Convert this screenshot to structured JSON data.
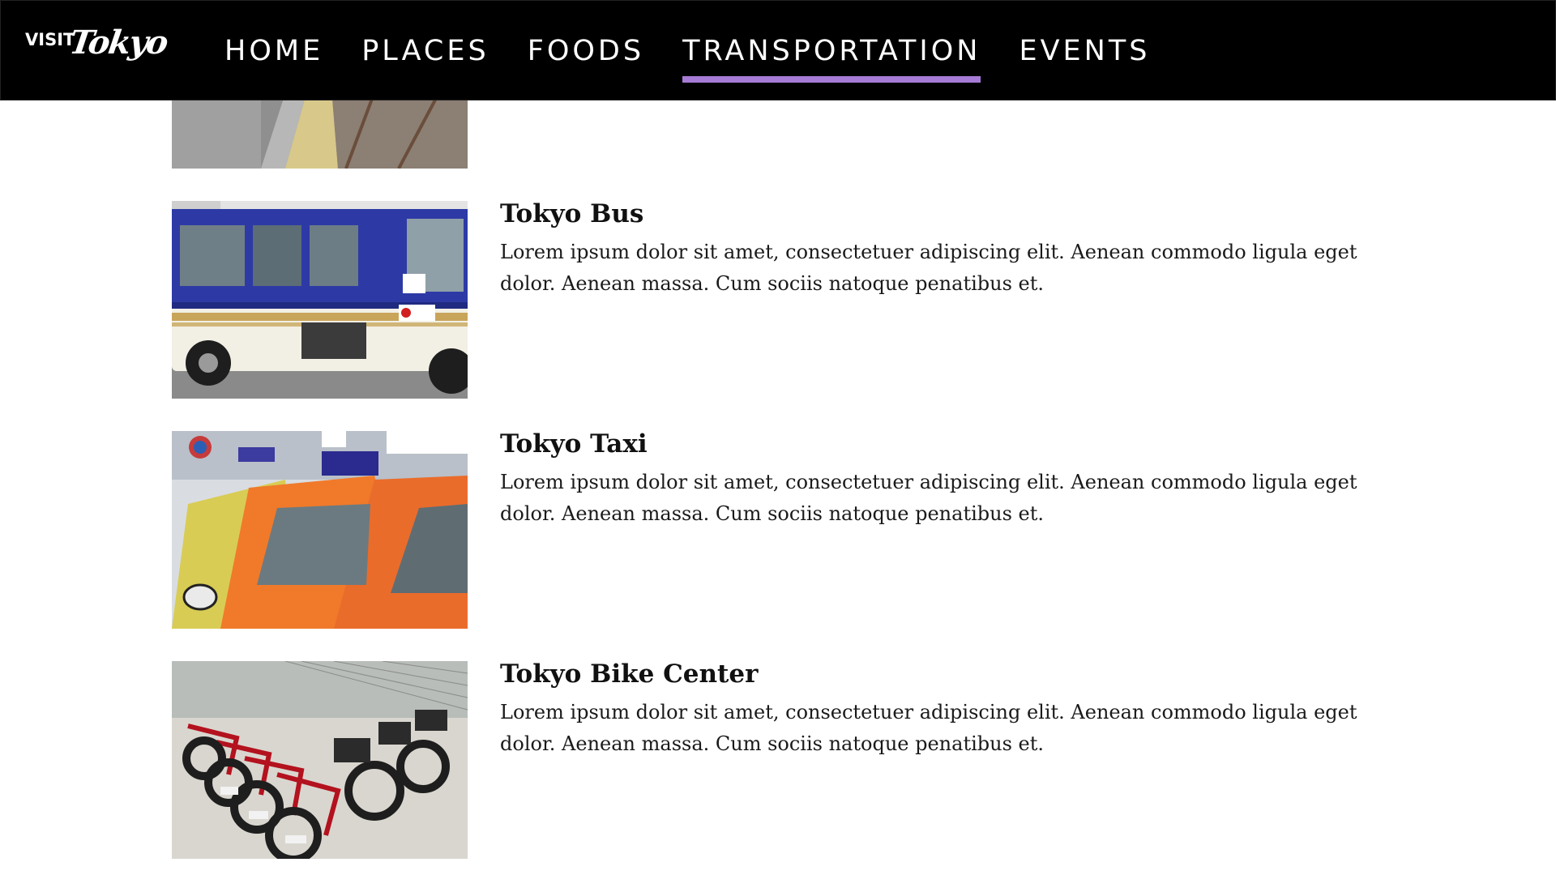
{
  "brand": {
    "logo_visit": "VISIT",
    "logo_tokyo": "Tokyo"
  },
  "nav": {
    "items": [
      {
        "label": "HOME"
      },
      {
        "label": "PLACES"
      },
      {
        "label": "FOODS"
      },
      {
        "label": "TRANSPORTATION",
        "active": true
      },
      {
        "label": "EVENTS"
      }
    ]
  },
  "colors": {
    "header_bg": "#000000",
    "accent": "#a57bd6",
    "text": "#111111"
  },
  "transport": [
    {
      "title": "",
      "image_icon": "train-platform-image"
    },
    {
      "title": "Tokyo Bus",
      "text": "Lorem ipsum dolor sit amet, consectetuer adipiscing elit. Aenean commodo ligula eget dolor. Aenean massa. Cum sociis natoque penatibus et.",
      "image_icon": "bus-image"
    },
    {
      "title": "Tokyo Taxi",
      "text": "Lorem ipsum dolor sit amet, consectetuer adipiscing elit. Aenean commodo ligula eget dolor. Aenean massa. Cum sociis natoque penatibus et.",
      "image_icon": "taxi-image"
    },
    {
      "title": "Tokyo Bike Center",
      "text": "Lorem ipsum dolor sit amet, consectetuer adipiscing elit. Aenean commodo ligula eget dolor. Aenean massa. Cum sociis natoque penatibus et.",
      "image_icon": "bicycles-image"
    }
  ]
}
